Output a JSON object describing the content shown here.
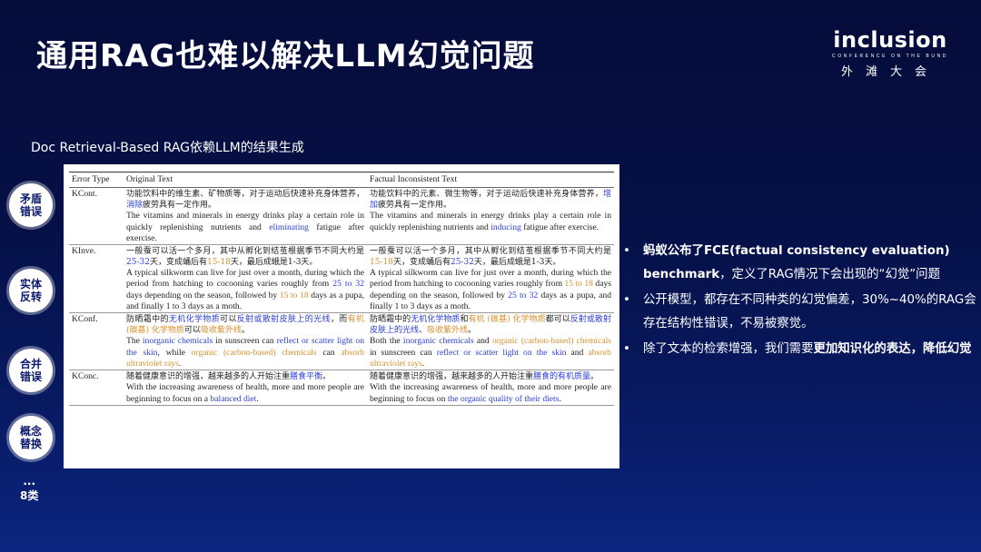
{
  "title": "通用RAG也难以解决LLM幻觉问题",
  "logo": {
    "word": "inclusion",
    "sub": "CONFERENCE ON THE BUND",
    "cn": "外滩大会"
  },
  "subtitle": "Doc Retrieval-Based RAG依赖LLM的结果生成",
  "badges": [
    "矛盾错误",
    "实体反转",
    "合并错误",
    "概念替换"
  ],
  "more": {
    "dots": "...",
    "label": "8类"
  },
  "table": {
    "headers": [
      "Error Type",
      "Original Text",
      "Factual Inconsistent Text"
    ],
    "rows": [
      {
        "type": "KCont.",
        "orig_cn": [
          {
            "t": "功能饮料中的维生素、矿物质等，对于运动后快速补充身体营养，"
          },
          {
            "t": "消除",
            "c": "b"
          },
          {
            "t": "疲劳具有一定作用。"
          }
        ],
        "orig_en": [
          {
            "t": "The vitamins and minerals in energy drinks play a certain role in quickly replenishing nutrients and "
          },
          {
            "t": "eliminating",
            "c": "b"
          },
          {
            "t": " fatigue after exercise."
          }
        ],
        "fact_cn": [
          {
            "t": "功能饮料中的元素、微生物等，对于运动后快速补充身体营养，"
          },
          {
            "t": "增加",
            "c": "b"
          },
          {
            "t": "疲劳具有一定作用。"
          }
        ],
        "fact_en": [
          {
            "t": "The vitamins and minerals in energy drinks play a certain role in quickly replenishing nutrients and "
          },
          {
            "t": "inducing",
            "c": "b"
          },
          {
            "t": " fatigue after exercise."
          }
        ]
      },
      {
        "type": "KInve.",
        "orig_cn": [
          {
            "t": "一般蚕可以活一个多月，其中从孵化到结茧根据季节不同大约是"
          },
          {
            "t": "25-32",
            "c": "b"
          },
          {
            "t": "天，变成蛹后有"
          },
          {
            "t": "15-18",
            "c": "o"
          },
          {
            "t": "天，最后成蛾是1-3天。"
          }
        ],
        "orig_en": [
          {
            "t": "A typical silkworm can live for just over a month, during which the period from hatching to cocooning varies roughly from "
          },
          {
            "t": "25 to 32",
            "c": "b"
          },
          {
            "t": " days depending on the season, followed by "
          },
          {
            "t": "15 to 18",
            "c": "o"
          },
          {
            "t": " days as a pupa, and finally 1 to 3 days as a moth."
          }
        ],
        "fact_cn": [
          {
            "t": "一般蚕可以活一个多月，其中从孵化到结茧根据季节不同大约是"
          },
          {
            "t": "15-18",
            "c": "o"
          },
          {
            "t": "天，变成蛹后有"
          },
          {
            "t": "25-32",
            "c": "b"
          },
          {
            "t": "天，最后成蛾是1-3天。"
          }
        ],
        "fact_en": [
          {
            "t": "A typical silkworm can live for just over a month, during which the period from hatching to cocooning varies roughly from "
          },
          {
            "t": "15 to 18",
            "c": "o"
          },
          {
            "t": " days depending on the season, followed by "
          },
          {
            "t": "25 to 32",
            "c": "b"
          },
          {
            "t": " days as a pupa, and finally 1 to 3 days as a moth."
          }
        ]
      },
      {
        "type": "KConf.",
        "orig_cn": [
          {
            "t": "防晒霜中的"
          },
          {
            "t": "无机化学物质",
            "c": "b"
          },
          {
            "t": "可以"
          },
          {
            "t": "反射或散射皮肤上的光线",
            "c": "b"
          },
          {
            "t": "，而"
          },
          {
            "t": "有机 (碳基) 化学物质",
            "c": "o"
          },
          {
            "t": "可以"
          },
          {
            "t": "吸收紫外线",
            "c": "o"
          },
          {
            "t": "。"
          }
        ],
        "orig_en": [
          {
            "t": "The "
          },
          {
            "t": "inorganic chemicals",
            "c": "b"
          },
          {
            "t": " in sunscreen can "
          },
          {
            "t": "reflect or scatter light on the skin",
            "c": "b"
          },
          {
            "t": ", while "
          },
          {
            "t": "organic (carbon-based) chemicals",
            "c": "o"
          },
          {
            "t": " can "
          },
          {
            "t": "absorb ultraviolet rays",
            "c": "o"
          },
          {
            "t": "."
          }
        ],
        "fact_cn": [
          {
            "t": "防晒霜中的"
          },
          {
            "t": "无机化学物质",
            "c": "b"
          },
          {
            "t": "和"
          },
          {
            "t": "有机 (碳基) 化学物质",
            "c": "o"
          },
          {
            "t": "都可以"
          },
          {
            "t": "反射或散射皮肤上的光线",
            "c": "b"
          },
          {
            "t": "、"
          },
          {
            "t": "吸收紫外线",
            "c": "o"
          },
          {
            "t": "。"
          }
        ],
        "fact_en": [
          {
            "t": "Both the "
          },
          {
            "t": "inorganic chemicals",
            "c": "b"
          },
          {
            "t": " and "
          },
          {
            "t": "organic (carbon-based) chemicals",
            "c": "o"
          },
          {
            "t": " in sunscreen can "
          },
          {
            "t": "reflect or scatter light on the skin",
            "c": "b"
          },
          {
            "t": " and "
          },
          {
            "t": "absorb ultraviolet rays",
            "c": "o"
          },
          {
            "t": "."
          }
        ]
      },
      {
        "type": "KConc.",
        "orig_cn": [
          {
            "t": "随着健康意识的增强，越来越多的人开始注重"
          },
          {
            "t": "膳食平衡",
            "c": "b"
          },
          {
            "t": "。"
          }
        ],
        "orig_en": [
          {
            "t": "With the increasing awareness of health, more and more people are beginning to focus on a "
          },
          {
            "t": "balanced diet",
            "c": "b"
          },
          {
            "t": "."
          }
        ],
        "fact_cn": [
          {
            "t": "随着健康意识的增强，越来越多的人开始注重"
          },
          {
            "t": "膳食的有机质量",
            "c": "b"
          },
          {
            "t": "。"
          }
        ],
        "fact_en": [
          {
            "t": "With the increasing awareness of health, more and more people are beginning to focus on "
          },
          {
            "t": "the organic quality of their diets",
            "c": "b"
          },
          {
            "t": "."
          }
        ]
      }
    ]
  },
  "bullets": [
    [
      {
        "t": "蚂蚁公布了FCE(factual consistency evaluation) benchmark",
        "bold": true
      },
      {
        "t": "，定义了RAG情况下会出现的“幻觉”问题"
      }
    ],
    [
      {
        "t": "公开模型，都存在不同种类的幻觉偏差，30%~40%的RAG会存在结构性错误，不易被察觉。"
      }
    ],
    [
      {
        "t": "除了文本的检索增强，我们需要"
      },
      {
        "t": "更加知识化的表达，降低幻觉",
        "bold": true
      }
    ]
  ],
  "bullet_symbol": "•",
  "colors": {
    "highlight_blue": "#2b3fd6",
    "highlight_orange": "#d8902e",
    "bg_top": "#050c3a",
    "bg_bottom": "#0b2580"
  }
}
